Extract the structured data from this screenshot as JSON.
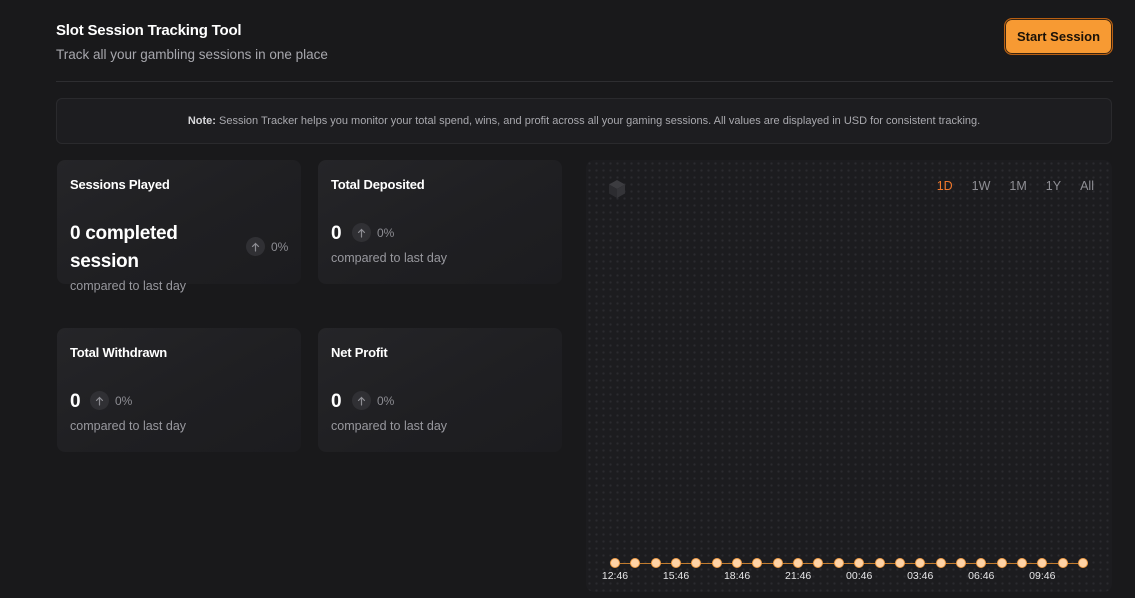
{
  "header": {
    "title": "Slot Session Tracking Tool",
    "subtitle": "Track all your gambling sessions in one place",
    "start_button": "Start Session"
  },
  "note": {
    "label": "Note:",
    "text": "Session Tracker helps you monitor your total spend, wins, and profit across all your gaming sessions. All values are displayed in USD for consistent tracking."
  },
  "stats": [
    {
      "title": "Sessions Played",
      "value": "0 completed",
      "value_line2": "session",
      "change": "0%",
      "compare": "compared to last day"
    },
    {
      "title": "Total Deposited",
      "value": "0",
      "change": "0%",
      "compare": "compared to last day"
    },
    {
      "title": "Total Withdrawn",
      "value": "0",
      "change": "0%",
      "compare": "compared to last day"
    },
    {
      "title": "Net Profit",
      "value": "0",
      "change": "0%",
      "compare": "compared to last day"
    }
  ],
  "chart": {
    "ranges": [
      "1D",
      "1W",
      "1M",
      "1Y",
      "All"
    ],
    "active_range": "1D",
    "accent_color": "#f79a33",
    "active_color": "#f0782c",
    "time_labels": [
      "12:46",
      "15:46",
      "18:46",
      "21:46",
      "00:46",
      "03:46",
      "06:46",
      "09:46"
    ],
    "icon": "cube-icon"
  }
}
